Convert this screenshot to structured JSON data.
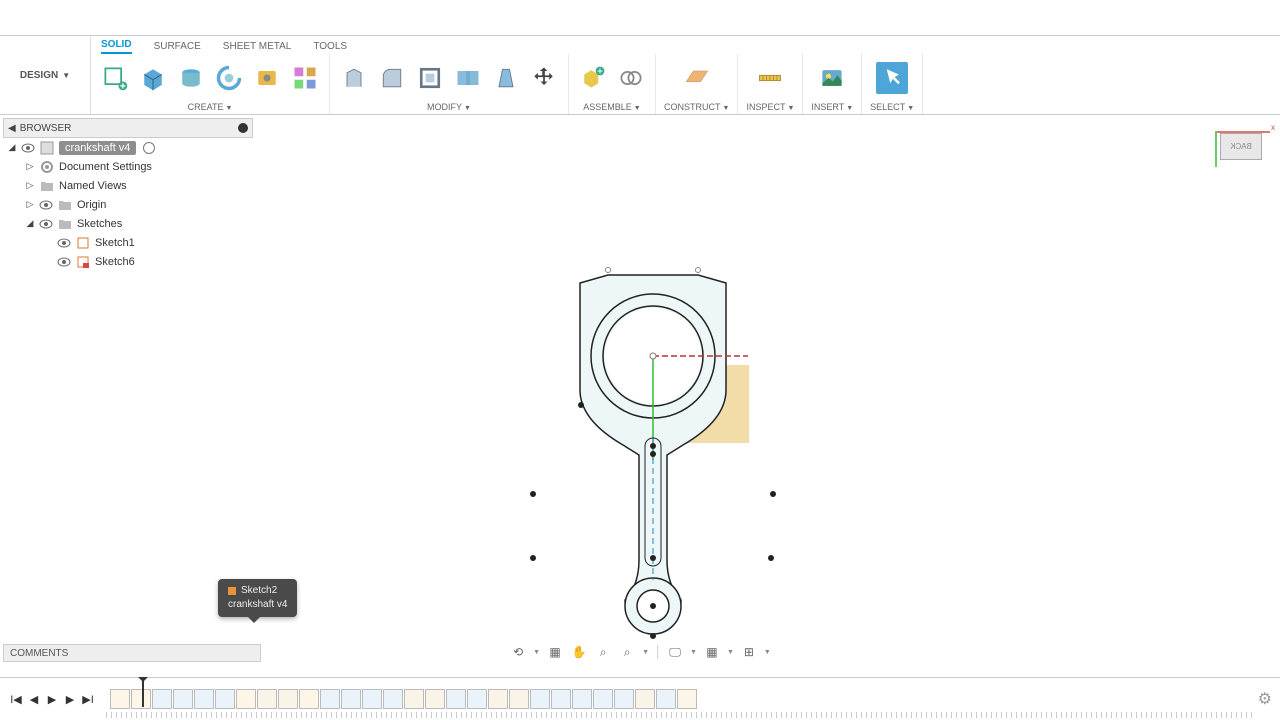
{
  "design_label": "DESIGN",
  "workspace_tabs": [
    "SOLID",
    "SURFACE",
    "SHEET METAL",
    "TOOLS"
  ],
  "active_tab": 0,
  "ribbon_groups": {
    "create": "CREATE",
    "modify": "MODIFY",
    "assemble": "ASSEMBLE",
    "construct": "CONSTRUCT",
    "inspect": "INSPECT",
    "insert": "INSERT",
    "select": "SELECT"
  },
  "browser": {
    "title": "BROWSER",
    "root": "crankshaft v4",
    "items": {
      "doc": "Document Settings",
      "named": "Named Views",
      "origin": "Origin",
      "sketches": "Sketches",
      "sk1": "Sketch1",
      "sk6": "Sketch6"
    }
  },
  "viewcube": {
    "face": "BACK",
    "x": "x"
  },
  "comments": "COMMENTS",
  "tooltip": {
    "name": "Sketch2",
    "parent": "crankshaft v4"
  },
  "timeline_items": 28
}
